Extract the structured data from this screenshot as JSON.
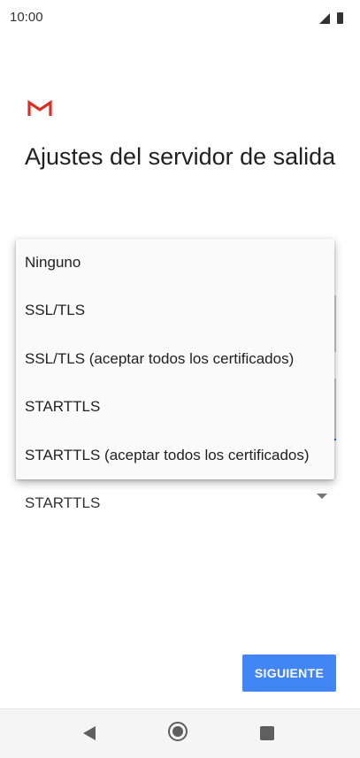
{
  "status_bar": {
    "time": "10:00",
    "icons": [
      "signal-icon",
      "battery-icon"
    ]
  },
  "header": {
    "logo": "gmail-logo-icon",
    "title": "Ajustes del servidor de salida"
  },
  "security_field": {
    "value": "STARTTLS"
  },
  "dropdown": {
    "options": [
      "Ninguno",
      "SSL/TLS",
      "SSL/TLS (aceptar todos los certificados)",
      "STARTTLS",
      "STARTTLS (aceptar todos los certificados)"
    ]
  },
  "footer": {
    "next_label": "SIGUIENTE"
  },
  "nav_bar": {
    "icons": [
      "back-icon",
      "home-icon",
      "recents-icon"
    ]
  },
  "colors": {
    "accent": "#4285f4",
    "gmail_red": "#d93025"
  }
}
